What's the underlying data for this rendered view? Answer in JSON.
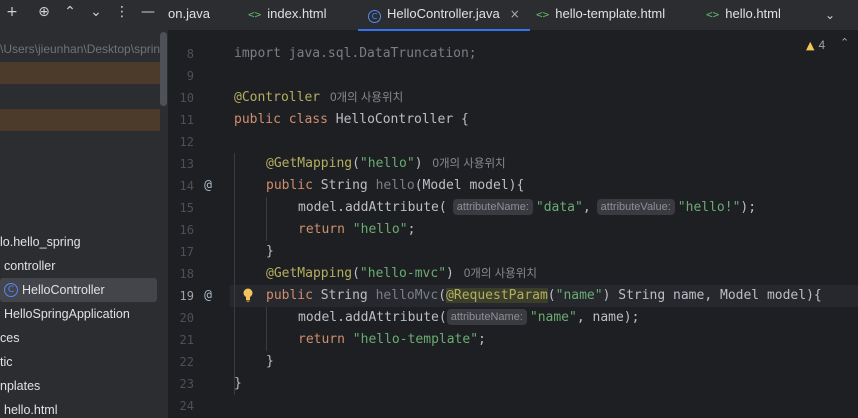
{
  "project_panel": {
    "toolbar": {
      "add_icon": "+",
      "locate_icon": "⊕",
      "expand_icon": "⌃",
      "collapse_icon": "⌄",
      "more_icon": "⋮",
      "hide_icon": "—"
    },
    "path_text": "\\Users\\jieunhan\\Desktop\\spring",
    "tree": [
      {
        "label": "lo.hello_spring"
      },
      {
        "label": "controller"
      },
      {
        "label": "HelloController",
        "icon": "C",
        "selected": true
      },
      {
        "label": "HelloSpringApplication"
      },
      {
        "label": "ces"
      },
      {
        "label": "tic"
      },
      {
        "label": "nplates"
      },
      {
        "label": "hello.html"
      }
    ]
  },
  "tabs": [
    {
      "label": "on.java",
      "icon": ""
    },
    {
      "label": "index.html",
      "icon": "<>"
    },
    {
      "label": "HelloController.java",
      "icon": "C",
      "active": true,
      "close": "×"
    },
    {
      "label": "hello-template.html",
      "icon": "<>"
    },
    {
      "label": "hello.html",
      "icon": "<>"
    }
  ],
  "tabs_dropdown_icon": "⌄",
  "editor": {
    "warning_count": "4",
    "warning_icon": "▲",
    "expand_icon": "⌃",
    "line_numbers": [
      "8",
      "9",
      "10",
      "11",
      "12",
      "13",
      "14",
      "15",
      "16",
      "17",
      "18",
      "19",
      "20",
      "21",
      "22",
      "23",
      "24"
    ],
    "current_line": "19",
    "gutter_marks": {
      "line14": "@",
      "line19": "@"
    },
    "code": {
      "l8": {
        "import": "import",
        "rest": " java.sql.DataTruncation;"
      },
      "l10": {
        "ann": "@Controller",
        "usage": "0개의 사용위치"
      },
      "l11": {
        "kw1": "public",
        "kw2": "class",
        "rest": " HelloController {"
      },
      "l13": {
        "ann": "@GetMapping",
        "p1": "(",
        "str": "\"hello\"",
        "p2": ")",
        "usage": "0개의 사용위치"
      },
      "l14": {
        "kw1": "public",
        "rest1": " String ",
        "fn": "hello",
        "rest2": "(Model model){"
      },
      "l15": {
        "pre": "model.addAttribute(",
        "hint1": "attributeName:",
        "str1": "\"data\"",
        "comma": ",",
        "hint2": "attributeValue:",
        "str2": "\"hello!\"",
        "end": ");"
      },
      "l16": {
        "kw": "return",
        "str": "\"hello\"",
        "end": ";"
      },
      "l17": {
        "text": "}"
      },
      "l18": {
        "ann": "@GetMapping",
        "p1": "(",
        "str": "\"hello-mvc\"",
        "p2": ")",
        "usage": "0개의 사용위치"
      },
      "l19": {
        "kw1": "public",
        "rest1": " String ",
        "fn": "helloMvc",
        "p1": "(",
        "ann": "@RequestParam",
        "p2": "(",
        "str": "\"name\"",
        "rest2": ") String name, Model model){"
      },
      "l20": {
        "pre": "model.addAttribute(",
        "hint": "attributeName:",
        "str": "\"name\"",
        "end": ", name);"
      },
      "l21": {
        "kw": "return",
        "str": "\"hello-template\"",
        "end": ";"
      },
      "l22": {
        "text": "}"
      },
      "l23": {
        "text": "}"
      }
    }
  },
  "colors": {
    "background": "#1e1f22",
    "keyword": "#cf8e6d",
    "string": "#6aab73",
    "annotation": "#b3ae60",
    "function": "#56a8f5",
    "accent": "#3574f0"
  }
}
